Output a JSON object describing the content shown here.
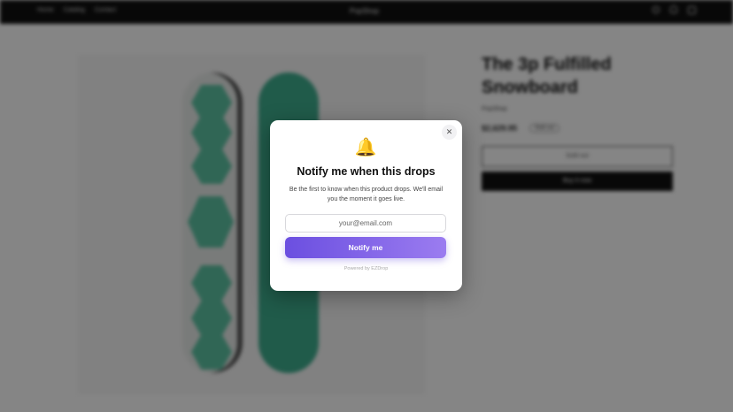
{
  "header": {
    "nav": [
      "Home",
      "Catalog",
      "Contact"
    ],
    "brand": "PopShop"
  },
  "product": {
    "title": "The 3p Fulfilled Snowboard",
    "vendor": "PopShop",
    "price": "$2,629.95",
    "badge": "Sold out",
    "sold_out_label": "Sold out",
    "buy_label": "Buy it now"
  },
  "modal": {
    "title": "Notify me when this drops",
    "description": "Be the first to know when this product drops. We'll email you the moment it goes live.",
    "email_placeholder": "your@email.com",
    "button_label": "Notify me",
    "powered_by": "Powered by EZDrop",
    "icon": "bell-icon",
    "close_icon": "close-icon"
  },
  "colors": {
    "accent_start": "#6b4fe0",
    "accent_end": "#9b7cf0",
    "header_bg": "#111111",
    "board_green": "#3fae8f"
  }
}
